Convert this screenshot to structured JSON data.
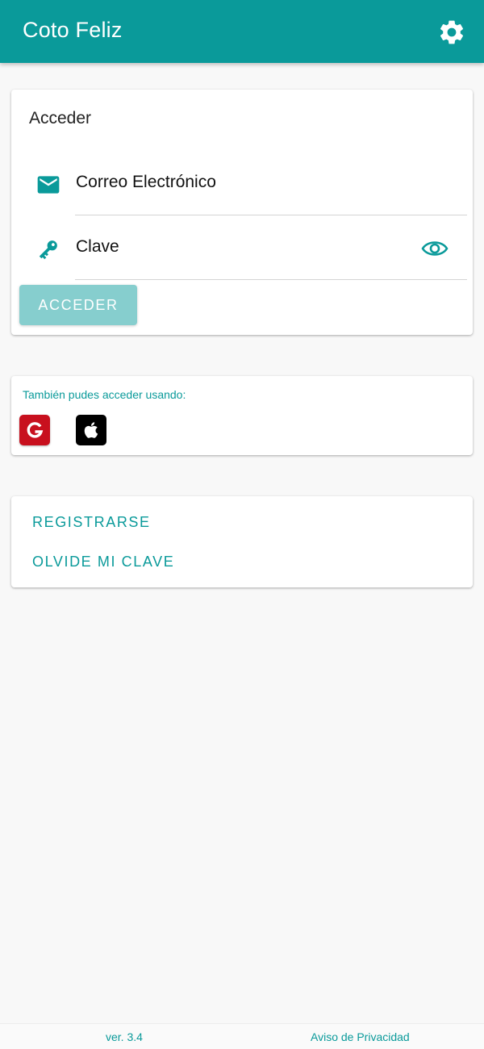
{
  "appbar": {
    "title": "Coto Feliz",
    "settings_icon": "gear-icon"
  },
  "login": {
    "title": "Acceder",
    "email_label": "Correo Electrónico",
    "email_icon": "mail-icon",
    "password_label": "Clave",
    "password_icon": "key-icon",
    "visibility_icon": "eye-icon",
    "submit_label": "ACCEDER"
  },
  "social": {
    "label": "También pudes acceder usando:",
    "providers": [
      {
        "icon": "google-icon",
        "letter": "G",
        "color": "#c8101e"
      },
      {
        "icon": "apple-icon",
        "color": "#000000"
      }
    ]
  },
  "links": {
    "register_label": "REGISTRARSE",
    "forgot_label": "OLVIDE MI CLAVE"
  },
  "footer": {
    "version": "ver. 3.4",
    "privacy_label": "Aviso de Privacidad"
  },
  "colors": {
    "primary": "#0a9a9a",
    "button_disabled": "#86cece",
    "background": "#f8f8f8"
  }
}
